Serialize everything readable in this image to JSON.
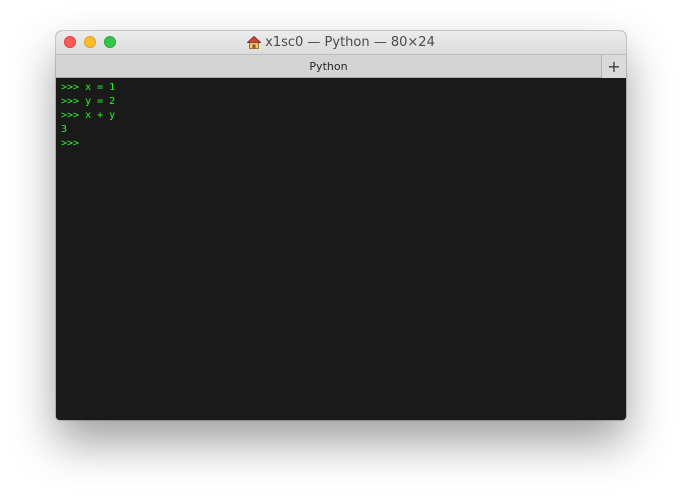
{
  "window": {
    "title": "x1sc0 — Python — 80×24"
  },
  "tabs": [
    {
      "label": "Python"
    }
  ],
  "new_tab_label": "+",
  "terminal": {
    "lines": [
      ">>> x = 1",
      ">>> y = 2",
      ">>> x + y",
      "3",
      ">>> "
    ]
  },
  "colors": {
    "terminal_bg": "#1a1a1a",
    "terminal_fg": "#29f629"
  },
  "icons": {
    "title": "home-icon"
  }
}
